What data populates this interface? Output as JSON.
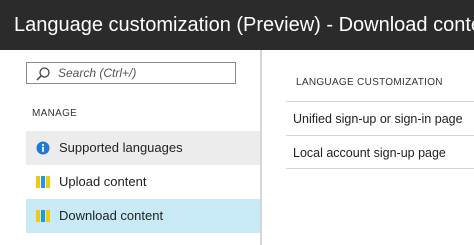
{
  "window": {
    "title": "Language customization (Preview) - Download content"
  },
  "search": {
    "placeholder": "Search (Ctrl+/)"
  },
  "sidebar": {
    "section_label": "MANAGE",
    "items": [
      {
        "label": "Supported languages",
        "icon": "info-icon"
      },
      {
        "label": "Upload content",
        "icon": "document-stack-icon"
      },
      {
        "label": "Download content",
        "icon": "document-stack-icon",
        "selected": true
      }
    ]
  },
  "main": {
    "section_label": "LANGUAGE CUSTOMIZATION",
    "items": [
      {
        "label": "Unified sign-up or sign-in page"
      },
      {
        "label": "Local account sign-up page"
      }
    ]
  },
  "colors": {
    "titlebar_bg": "#2b2b2b",
    "selected_bg": "#c8eaf7",
    "hover_bg": "#ececec",
    "info_blue": "#1e7ad8",
    "icon_yellow": "#f2c811",
    "icon_blue": "#1e9bd7"
  }
}
